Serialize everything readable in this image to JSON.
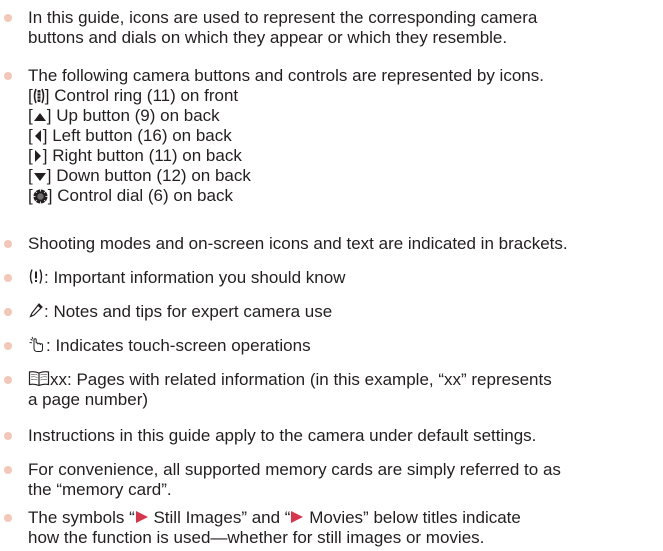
{
  "colors": {
    "bullet": "#f2c7b8",
    "text": "#231f20",
    "arrow": "#d8344c"
  },
  "items": [
    {
      "lines": [
        "In this guide, icons are used to represent the corresponding camera",
        "buttons and dials on which they appear or which they resemble."
      ]
    },
    {
      "intro": "The following camera buttons and controls are represented by icons.",
      "controls": [
        {
          "icon": "control-ring-icon",
          "text": "Control ring (11) on front"
        },
        {
          "icon": "up-button-icon",
          "text": "Up button (9) on back"
        },
        {
          "icon": "left-button-icon",
          "text": "Left button (16) on back"
        },
        {
          "icon": "right-button-icon",
          "text": "Right button (11) on back"
        },
        {
          "icon": "down-button-icon",
          "text": "Down button (12) on back"
        },
        {
          "icon": "control-dial-icon",
          "text": "Control dial (6) on back"
        }
      ]
    },
    {
      "lines": [
        "Shooting modes and on-screen icons and text are indicated in brackets."
      ]
    },
    {
      "icon": "important-icon",
      "text": ": Important information you should know"
    },
    {
      "icon": "pencil-icon",
      "text": ": Notes and tips for expert camera use"
    },
    {
      "icon": "touch-icon",
      "text": ": Indicates touch-screen operations"
    },
    {
      "icon": "book-icon",
      "lines": [
        "xx: Pages with related information (in this example, “xx” represents",
        "a page number)"
      ]
    },
    {
      "lines": [
        "Instructions in this guide apply to the camera under default settings."
      ]
    },
    {
      "lines": [
        "For convenience, all supported memory cards are simply referred to as",
        "the “memory card”."
      ]
    },
    {
      "symbols": {
        "pre": "The symbols “",
        "still": " Still Images” and “",
        "movies": " Movies” below titles indicate"
      },
      "lines": [
        "how the function is used—whether for still images or movies."
      ]
    }
  ]
}
